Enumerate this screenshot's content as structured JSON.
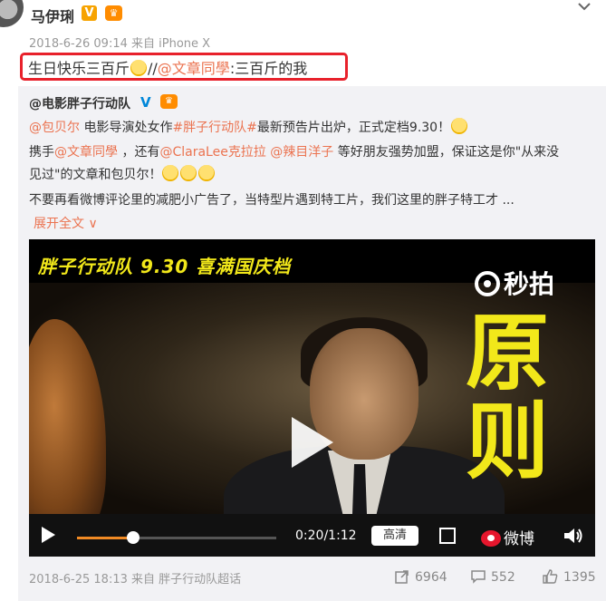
{
  "post": {
    "author": "马伊琍",
    "verified_mark": "V",
    "meta": "2018-6-26 09:14 来自 iPhone X",
    "text_part1": "生日快乐三百斤",
    "text_sep": "//",
    "mention": "@文章同學",
    "text_part2": ":三百斤的我"
  },
  "repost": {
    "author": "@电影胖子行动队",
    "line1_mention": "@包贝尔",
    "line1_text": " 电影导演处女作",
    "line1_tag": "#胖子行动队#",
    "line1_rest": "最新预告片出炉，正式定档9.30！",
    "line2_start": "携手",
    "line2_mention1": "@文章同學",
    "line2_mid1": " ，还有",
    "line2_mention2": "@ClaraLee克拉拉",
    "line2_mid2": " ",
    "line2_mention3": "@辣目洋子",
    "line2_rest": " 等好朋友强势加盟，保证这是你\"从来没",
    "line3": "见过\"的文章和包贝尔！",
    "line4": "不要再看微博评论里的减肥小广告了，当特型片遇到特工片，我们这里的胖子特工才 ...",
    "expand": "展开全文 ∨"
  },
  "video": {
    "title": "胖子行动队 9.30 喜满国庆档",
    "char1": "原",
    "char2": "则",
    "brand": "秒拍",
    "time": "0:20/1:12",
    "progress": 0.28,
    "hd_label": "高清",
    "weibo_label": "微博"
  },
  "footer": {
    "meta": "2018-6-25 18:13 来自 胖子行动队超话",
    "reposts": "6964",
    "comments": "552",
    "likes": "1395"
  },
  "colors": {
    "link": "#eb7350",
    "highlight": "#e8212b",
    "video_text": "#f2e81a"
  }
}
